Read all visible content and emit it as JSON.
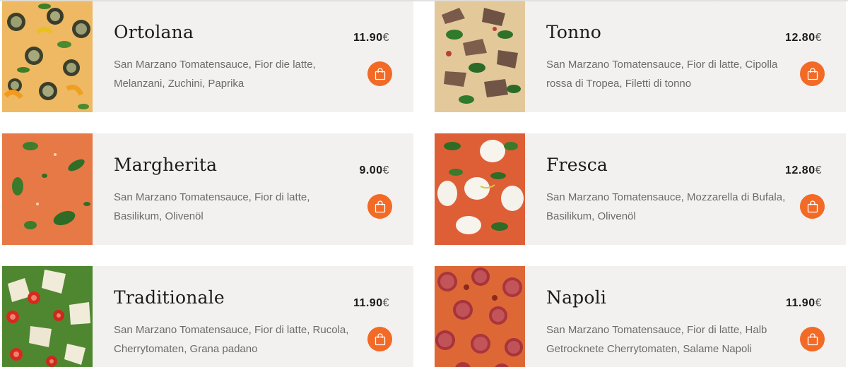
{
  "menu": {
    "items": [
      {
        "name": "Ortolana",
        "description": "San Marzano Tomatensauce, Fior die latte, Melanzani, Zuchini, Paprika",
        "price": "11.90",
        "currency": "€",
        "image_icon": "pizza-ortolana-photo"
      },
      {
        "name": "Tonno",
        "description": "San Marzano Tomatensauce, Fior di latte, Cipolla rossa di Tropea, Filetti di tonno",
        "price": "12.80",
        "currency": "€",
        "image_icon": "pizza-tonno-photo"
      },
      {
        "name": "Margherita",
        "description": "San Marzano Tomatensauce, Fior di latte, Basilikum, Olivenöl",
        "price": "9.00",
        "currency": "€",
        "image_icon": "pizza-margherita-photo"
      },
      {
        "name": "Fresca",
        "description": "San Marzano Tomatensauce, Mozzarella di Bufala, Basilikum, Olivenöl",
        "price": "12.80",
        "currency": "€",
        "image_icon": "pizza-fresca-photo"
      },
      {
        "name": "Traditionale",
        "description": "San Marzano Tomatensauce, Fior di latte, Rucola, Cherrytomaten, Grana padano",
        "price": "11.90",
        "currency": "€",
        "image_icon": "pizza-traditionale-photo"
      },
      {
        "name": "Napoli",
        "description": "San Marzano Tomatensauce, Fior di latte, Halb Getrocknete Cherrytomaten, Salame Napoli",
        "price": "11.90",
        "currency": "€",
        "image_icon": "pizza-napoli-photo"
      }
    ],
    "cart_button_icon": "shopping-bag-icon",
    "colors": {
      "card_bg": "#f2f1f0",
      "accent": "#f26a26",
      "price_text": "#1a1a1a",
      "desc_text": "#6b6b6b"
    }
  }
}
